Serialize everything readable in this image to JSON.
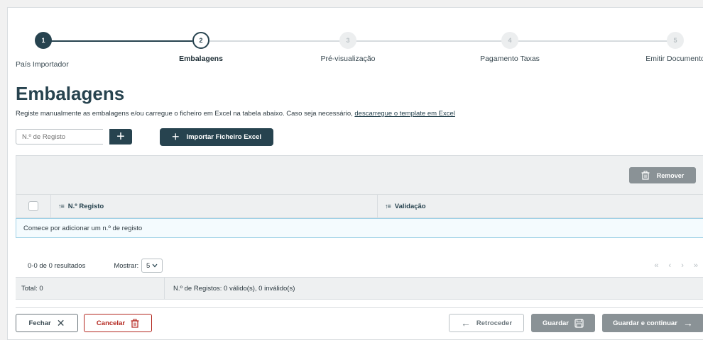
{
  "stepper": {
    "steps": [
      {
        "number": "1",
        "label": "País Importador",
        "state": "done"
      },
      {
        "number": "2",
        "label": "Embalagens",
        "state": "current"
      },
      {
        "number": "3",
        "label": "Pré-visualização",
        "state": "todo"
      },
      {
        "number": "4",
        "label": "Pagamento Taxas",
        "state": "todo"
      },
      {
        "number": "5",
        "label": "Emitir Documento",
        "state": "todo"
      }
    ]
  },
  "page": {
    "title": "Embalagens",
    "intro_text": "Registe manualmente as embalagens e/ou carregue o ficheiro em Excel na tabela abaixo. Caso seja necessário, ",
    "intro_link": "descarregue o template em Excel"
  },
  "register": {
    "placeholder": "N.º de Registo",
    "add_icon": "plus-icon",
    "import_label": "Importar Ficheiro Excel"
  },
  "table": {
    "remove_label": "Remover",
    "columns": [
      "N.º Registo",
      "Validação"
    ],
    "empty_message": "Comece por adicionar um n.º de registo"
  },
  "pagination": {
    "results": "0-0 de 0 resultados",
    "show_label": "Mostrar:",
    "page_size": "5"
  },
  "totals": {
    "total": "Total: 0",
    "registos": "N.º de Registos: 0 válido(s), 0 inválido(s)"
  },
  "footer": {
    "close_label": "Fechar",
    "cancel_label": "Cancelar",
    "back_label": "Retroceder",
    "save_label": "Guardar",
    "save_continue_label": "Guardar e continuar"
  },
  "colors": {
    "primary": "#27434f",
    "disabled": "#8a9296",
    "danger": "#b3261e",
    "row_highlight": "#9fd1e6"
  }
}
